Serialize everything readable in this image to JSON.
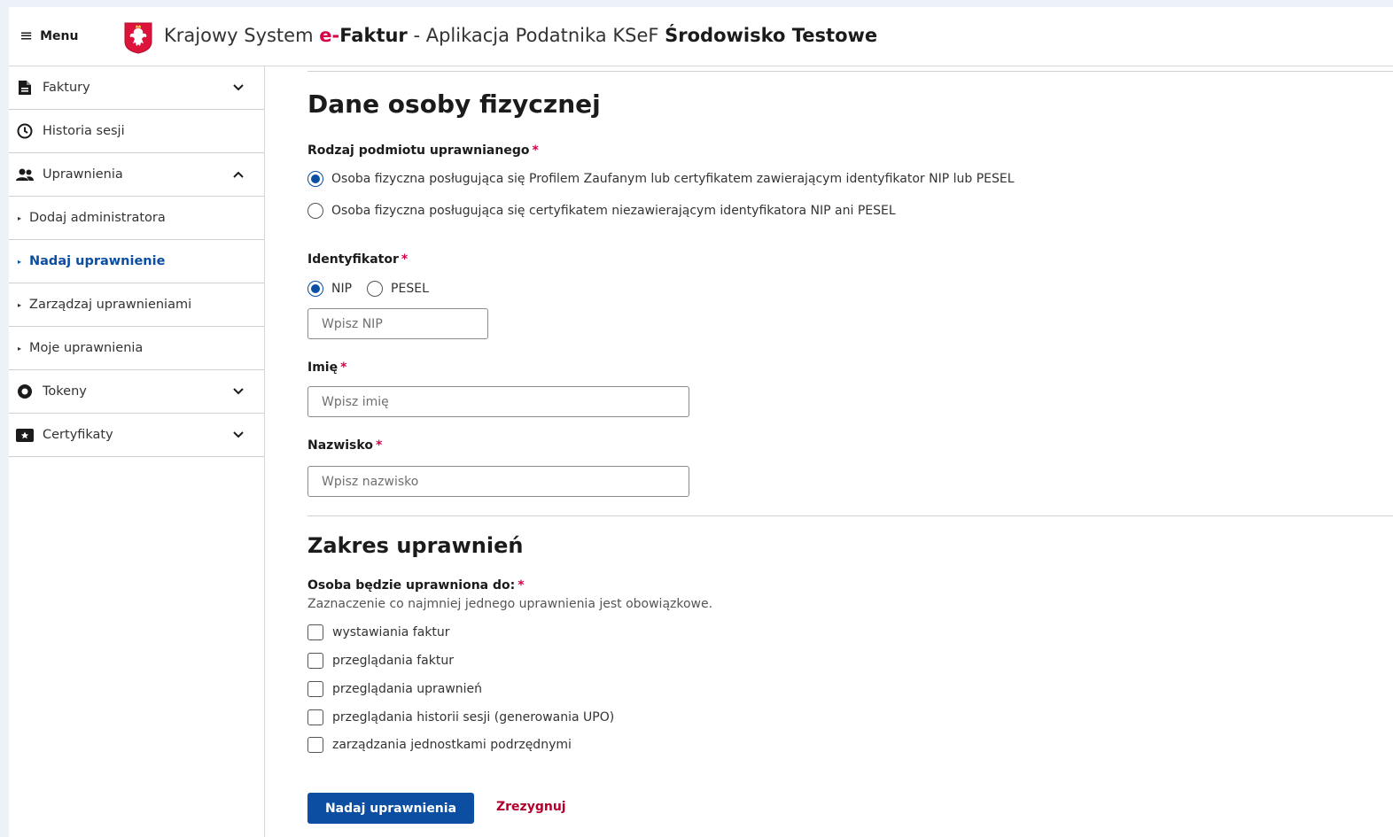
{
  "header": {
    "menu_label": "Menu",
    "title_prefix": "Krajowy System ",
    "title_brand_accent": "e-",
    "title_brand_bold": "Faktur",
    "title_suffix": " - Aplikacja Podatnika KSeF ",
    "title_env": "Środowisko Testowe"
  },
  "sidebar": {
    "items": [
      {
        "label": "Faktury",
        "icon": "document-icon",
        "chevron": "down"
      },
      {
        "label": "Historia sesji",
        "icon": "clock-icon"
      },
      {
        "label": "Uprawnienia",
        "icon": "users-icon",
        "chevron": "up"
      },
      {
        "label": "Dodaj administratora"
      },
      {
        "label": "Nadaj uprawnienie",
        "active": true
      },
      {
        "label": "Zarządzaj uprawnieniami"
      },
      {
        "label": "Moje uprawnienia"
      },
      {
        "label": "Tokeny",
        "icon": "token-icon",
        "chevron": "down"
      },
      {
        "label": "Certyfikaty",
        "icon": "certificate-icon",
        "chevron": "down"
      }
    ]
  },
  "form": {
    "section_title": "Dane osoby fizycznej",
    "subject_type": {
      "label": "Rodzaj podmiotu uprawnianego",
      "options": [
        "Osoba fizyczna posługująca się Profilem Zaufanym lub certyfikatem zawierającym identyfikator NIP lub PESEL",
        "Osoba fizyczna posługująca się certyfikatem niezawierającym identyfikatora NIP ani PESEL"
      ],
      "selected_index": 0
    },
    "identifier": {
      "label": "Identyfikator",
      "options": [
        "NIP",
        "PESEL"
      ],
      "selected_index": 0,
      "placeholder": "Wpisz NIP",
      "value": ""
    },
    "first_name": {
      "label": "Imię",
      "placeholder": "Wpisz imię",
      "value": ""
    },
    "last_name": {
      "label": "Nazwisko",
      "placeholder": "Wpisz nazwisko",
      "value": ""
    },
    "required_marker": "*"
  },
  "scope": {
    "title": "Zakres uprawnień",
    "label": "Osoba będzie uprawniona do:",
    "hint": "Zaznaczenie co najmniej jednego uprawnienia jest obowiązkowe.",
    "permissions": [
      {
        "label": "wystawiania faktur",
        "checked": false
      },
      {
        "label": "przeglądania faktur",
        "checked": false
      },
      {
        "label": "przeglądania uprawnień",
        "checked": false
      },
      {
        "label": "przeglądania historii sesji (generowania UPO)",
        "checked": false
      },
      {
        "label": "zarządzania jednostkami podrzędnymi",
        "checked": false
      }
    ]
  },
  "actions": {
    "submit_label": "Nadaj uprawnienia",
    "cancel_label": "Zrezygnuj"
  },
  "colors": {
    "primary": "#0b4ea2",
    "required": "#d4004a",
    "cancel": "#b0002b",
    "page_background": "#edf2f8"
  }
}
